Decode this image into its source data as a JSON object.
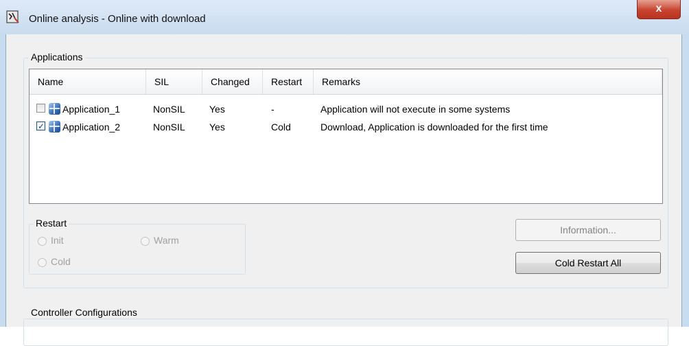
{
  "window": {
    "title": "Online analysis - Online with download",
    "close_label": "x"
  },
  "applications": {
    "group_label": "Applications",
    "columns": [
      "Name",
      "SIL",
      "Changed",
      "Restart",
      "Remarks"
    ],
    "rows": [
      {
        "checked": false,
        "name": "Application_1",
        "sil": "NonSIL",
        "changed": "Yes",
        "restart": "-",
        "remarks": "Application will not execute in some systems"
      },
      {
        "checked": true,
        "name": "Application_2",
        "sil": "NonSIL",
        "changed": "Yes",
        "restart": "Cold",
        "remarks": "Download, Application is downloaded for the first time"
      }
    ]
  },
  "restart": {
    "group_label": "Restart",
    "options": [
      "Init",
      "Warm",
      "Cold"
    ]
  },
  "buttons": {
    "information": "Information...",
    "cold_restart_all": "Cold Restart All"
  },
  "controller": {
    "group_label": "Controller Configurations"
  }
}
